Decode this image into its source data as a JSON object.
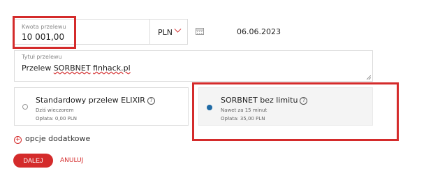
{
  "amount": {
    "label": "Kwota przelewu",
    "value": "10 001,00"
  },
  "currency": {
    "value": "PLN"
  },
  "date": {
    "value": "06.06.2023"
  },
  "title_field": {
    "label": "Tytuł przelewu",
    "word1": "Przelew",
    "word2": "SORBNET",
    "word3": "finhack.pl"
  },
  "options": [
    {
      "title": "Standardowy przelew ELIXIR",
      "line1": "Dziś wieczorem",
      "line2": "Opłata: 0,00 PLN",
      "selected": false
    },
    {
      "title": "SORBNET bez limitu",
      "line1": "Nawet za 15 minut",
      "line2": "Opłata: 35,00 PLN",
      "selected": true
    }
  ],
  "extra_options": {
    "label": "opcje dodatkowe"
  },
  "buttons": {
    "next": "DALEJ",
    "cancel": "ANULUJ"
  },
  "icons": {
    "help": "?",
    "plus": "+"
  },
  "colors": {
    "accent": "#d42b2b",
    "radio_selected": "#1f6aa5",
    "highlight_frame": "#d42b2b"
  }
}
